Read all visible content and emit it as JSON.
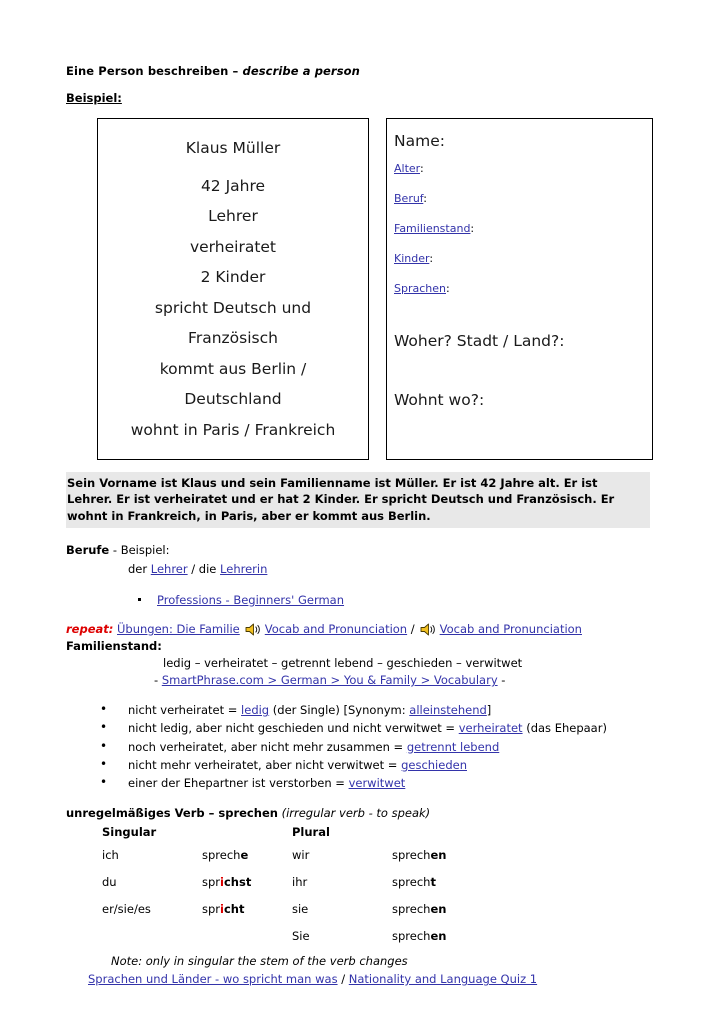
{
  "document": {
    "title_de": "Eine Person beschreiben",
    "title_dash": " – ",
    "title_en": "describe a person",
    "beispiel_label": "Beispiel:"
  },
  "example_card": {
    "lines": [
      "Klaus Müller",
      "42 Jahre",
      "Lehrer",
      "verheiratet",
      "2 Kinder",
      "spricht Deutsch und",
      "Französisch",
      "kommt aus Berlin /",
      "Deutschland",
      "wohnt in Paris / Frankreich"
    ]
  },
  "form_card": {
    "name_label": "Name:",
    "fields": [
      {
        "label": "Alter",
        "colon": ":"
      },
      {
        "label": "Beruf",
        "colon": ":"
      },
      {
        "label": "Familienstand",
        "colon": ":"
      },
      {
        "label": "Kinder",
        "colon": ":"
      },
      {
        "label": "Sprachen",
        "colon": ":"
      }
    ],
    "woher_label": "Woher?  Stadt / Land?:",
    "wohnt_label": "Wohnt wo?:"
  },
  "summary": {
    "text": "Sein Vorname ist Klaus und sein Familienname ist Müller. Er ist 42 Jahre alt. Er ist Lehrer. Er ist verheiratet und er hat 2 Kinder. Er spricht Deutsch und Französisch. Er wohnt in Frankreich, in Paris, aber er kommt aus Berlin.",
    "background": "#e8e8e8"
  },
  "berufe": {
    "heading": "Berufe",
    "heading_rest": " - Beispiel:",
    "line_prefix": "der ",
    "link_masc": "Lehrer",
    "line_mid": "  / die ",
    "link_fem": "Lehrerin",
    "bullet_link": "Professions - Beginners' German"
  },
  "repeat": {
    "label": "repeat:",
    "link_uebungen": "Übungen: Die Familie",
    "link_vocab_1": "Vocab and Pronunciation",
    "separator": "/",
    "link_vocab_2": "Vocab and Pronunciation",
    "speaker_icon": "speaker-icon"
  },
  "familienstand": {
    "heading": "Familienstand:",
    "words": "ledig – verheiratet – getrennt lebend – geschieden – verwitwet",
    "source_prefix": "- ",
    "source_link": "SmartPhrase.com > German > You & Family > Vocabulary",
    "source_suffix": " -",
    "items": [
      {
        "pre": "nicht verheiratet = ",
        "link": "ledig",
        "post": " (der Single) [Synonym: ",
        "link2": "alleinstehend",
        "post2": "]"
      },
      {
        "pre": "nicht ledig, aber nicht geschieden und nicht verwitwet =  ",
        "link": "verheiratet",
        "post": " (das Ehepaar)",
        "link2": "",
        "post2": ""
      },
      {
        "pre": "noch verheiratet, aber nicht mehr zusammen = ",
        "link": "getrennt lebend",
        "post": "",
        "link2": "",
        "post2": ""
      },
      {
        "pre": "nicht mehr verheiratet, aber nicht verwitwet = ",
        "link": "geschieden",
        "post": "",
        "link2": "",
        "post2": ""
      },
      {
        "pre": "einer der Ehepartner ist verstorben = ",
        "link": "verwitwet",
        "post": "",
        "link2": "",
        "post2": ""
      }
    ]
  },
  "verb": {
    "heading_bold": "unregelmäßiges Verb – sprechen",
    "heading_en": " (irregular verb - to speak)",
    "col_singular": "Singular",
    "col_plural": "Plural",
    "rows": [
      {
        "sg_pronoun": "ich",
        "sg_stem": "sprech",
        "sg_mid": "",
        "sg_mid2": "",
        "sg_end": "e",
        "pl_pronoun": "wir",
        "pl_stem": "sprech",
        "pl_end": "en"
      },
      {
        "sg_pronoun": "du",
        "sg_stem": "spr",
        "sg_mid": "i",
        "sg_mid2": "ch",
        "sg_end": "st",
        "pl_pronoun": "ihr",
        "pl_stem": "sprech",
        "pl_end": "t"
      },
      {
        "sg_pronoun": "er/sie/es",
        "sg_stem": "spr",
        "sg_mid": "i",
        "sg_mid2": "ch",
        "sg_end": "t",
        "pl_pronoun": "sie",
        "pl_stem": "sprech",
        "pl_end": "en"
      },
      {
        "sg_pronoun": "",
        "sg_stem": "",
        "sg_mid": "",
        "sg_mid2": "",
        "sg_end": "",
        "pl_pronoun": "Sie",
        "pl_stem": "sprech",
        "pl_end": "en"
      }
    ],
    "note": "Note: only in singular the stem of the verb changes",
    "highlight_color": "#dd0000"
  },
  "footer": {
    "link_left": "Sprachen und Länder - wo spricht man was",
    "separator": "  /  ",
    "link_right": "Nationality and Language Quiz 1"
  }
}
